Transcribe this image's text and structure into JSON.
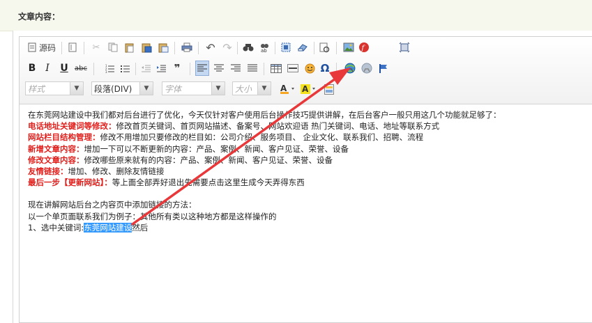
{
  "header": {
    "label": "文章内容："
  },
  "toolbar": {
    "source_label": "源码",
    "format_style": "样式",
    "format_paragraph": "段落(DIV)",
    "format_font": "字体",
    "format_size": "大小",
    "icons": [
      "document-icon",
      "templates-icon",
      "cut-icon",
      "copy-icon",
      "paste-icon",
      "paste-text-icon",
      "paste-word-icon",
      "print-icon",
      "undo-icon",
      "redo-icon",
      "find-icon",
      "replace-icon",
      "select-all-icon",
      "remove-format-icon",
      "spellcheck-icon",
      "image-icon",
      "flash-icon",
      "maximize-icon",
      "bold-icon",
      "italic-icon",
      "underline-icon",
      "strikethrough-icon",
      "numbered-list-icon",
      "bulleted-list-icon",
      "outdent-icon",
      "indent-icon",
      "blockquote-icon",
      "align-left-icon",
      "align-center-icon",
      "align-right-icon",
      "justify-icon",
      "table-icon",
      "horizontal-rule-icon",
      "smiley-icon",
      "special-char-icon",
      "link-icon",
      "unlink-icon",
      "anchor-icon",
      "text-color-icon",
      "bg-color-icon",
      "show-blocks-icon"
    ]
  },
  "content": {
    "intro": "在东莞网站建设中我们都对后台进行了优化，今天仅针对客户使用后台操作技巧提供讲解，在后台客户一般只用这几个功能就足够了：",
    "items": [
      {
        "label": "电话地址关键词等修改：",
        "text": "修改首页关键词、首页网站描述、备案号、网站欢迎语 热门关键词、电话、地址等联系方式"
      },
      {
        "label": "网站栏目结构管理：",
        "text": "修改不用增加只要修改的栏目如：公司介绍、服务项目、 企业文化、联系我们、招聘、流程"
      },
      {
        "label": "新增文章内容：",
        "text": "增加一下可以不断更新的内容：产品、案例、新闻、客户见证、荣誉、设备"
      },
      {
        "label": "修改文章内容：",
        "text": "修改哪些原来就有的内容：产品、案例、新闻、客户见证、荣誉、设备"
      },
      {
        "label": "友情链接：",
        "text": "增加、修改、删除友情链接"
      },
      {
        "label": "最后一步【更新网站】：",
        "text": "等上面全部弄好退出先需要点击这里生成今天弄得东西"
      }
    ],
    "section2_title": "现在讲解网站后台之内容页中添加链接的方法：",
    "section2_example": "以一个单页面联系我们为例子：其他所有类以这种地方都是这样操作的",
    "step1_prefix": "1、选中关键词:",
    "step1_selected": "东莞网站建设",
    "step1_suffix": "然后"
  },
  "colors": {
    "accent_red": "#e0201c",
    "arrow": "#e8383a",
    "selection": "#3399ff"
  }
}
